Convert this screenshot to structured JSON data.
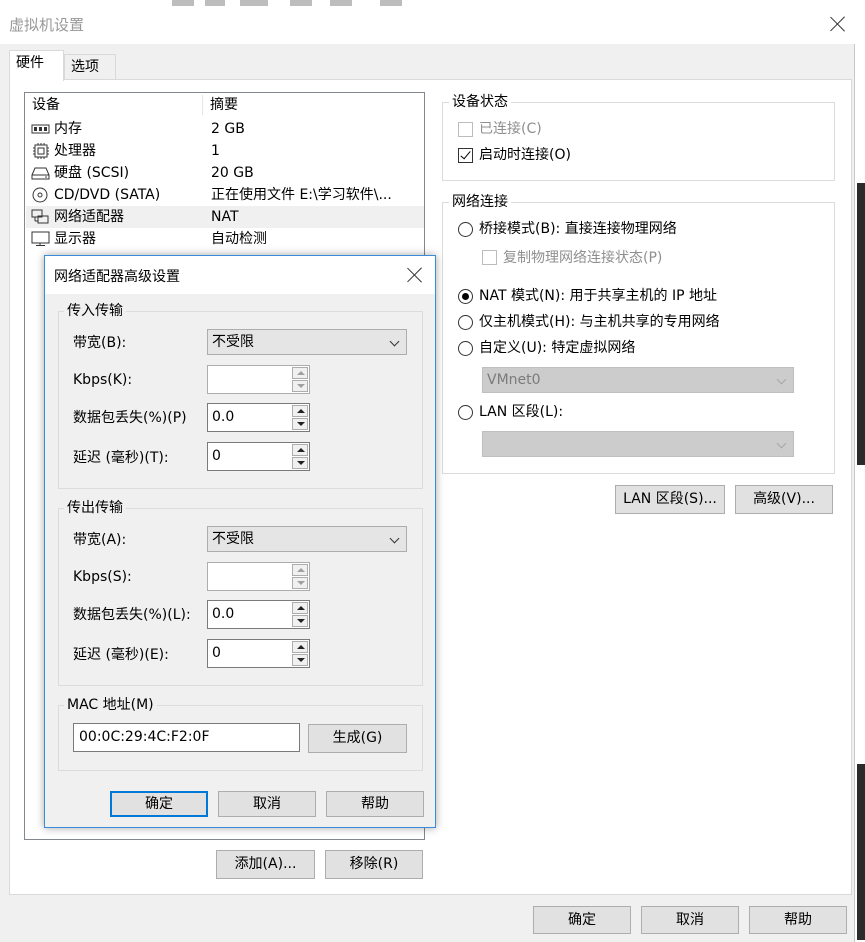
{
  "window": {
    "title": "虚拟机设置"
  },
  "tabs": [
    {
      "label": "硬件",
      "active": true
    },
    {
      "label": "选项",
      "active": false
    }
  ],
  "device_list": {
    "col_device": "设备",
    "col_summary": "摘要",
    "rows": [
      {
        "icon": "memory-icon",
        "name": "内存",
        "summary": "2 GB"
      },
      {
        "icon": "processor-icon",
        "name": "处理器",
        "summary": "1"
      },
      {
        "icon": "hard-disk-icon",
        "name": "硬盘 (SCSI)",
        "summary": "20 GB"
      },
      {
        "icon": "cd-dvd-icon",
        "name": "CD/DVD (SATA)",
        "summary": "正在使用文件 E:\\学习软件\\..."
      },
      {
        "icon": "network-adapter-icon",
        "name": "网络适配器",
        "summary": "NAT",
        "selected": true
      },
      {
        "icon": "display-icon",
        "name": "显示器",
        "summary": "自动检测"
      }
    ]
  },
  "device_buttons": {
    "add": "添加(A)...",
    "remove": "移除(R)"
  },
  "device_status": {
    "title": "设备状态",
    "connected": {
      "label": "已连接(C)",
      "checked": false,
      "disabled": true
    },
    "connect_on_power": {
      "label": "启动时连接(O)",
      "checked": true
    }
  },
  "network": {
    "title": "网络连接",
    "bridged": {
      "label": "桥接模式(B): 直接连接物理网络",
      "checked": false
    },
    "replicate": {
      "label": "复制物理网络连接状态(P)",
      "checked": false,
      "disabled": true
    },
    "nat": {
      "label": "NAT 模式(N): 用于共享主机的 IP 地址",
      "checked": true
    },
    "host_only": {
      "label": "仅主机模式(H): 与主机共享的专用网络",
      "checked": false
    },
    "custom": {
      "label": "自定义(U): 特定虚拟网络",
      "checked": false
    },
    "custom_value": "VMnet0",
    "lan_segment": {
      "label": "LAN 区段(L):",
      "checked": false
    },
    "lan_segment_value": ""
  },
  "network_buttons": {
    "lan_segments": "LAN 区段(S)...",
    "advanced": "高级(V)..."
  },
  "bottom_buttons": {
    "ok": "确定",
    "cancel": "取消",
    "help": "帮助"
  },
  "advanced_dialog": {
    "title": "网络适配器高级设置",
    "incoming": {
      "title": "传入传输",
      "bandwidth_label": "带宽(B):",
      "bandwidth_value": "不受限",
      "kbps_label": "Kbps(K):",
      "kbps_value": "",
      "loss_label": "数据包丢失(%)(P)",
      "loss_value": "0.0",
      "latency_label": "延迟 (毫秒)(T):",
      "latency_value": "0"
    },
    "outgoing": {
      "title": "传出传输",
      "bandwidth_label": "带宽(A):",
      "bandwidth_value": "不受限",
      "kbps_label": "Kbps(S):",
      "kbps_value": "",
      "loss_label": "数据包丢失(%)(L):",
      "loss_value": "0.0",
      "latency_label": "延迟 (毫秒)(E):",
      "latency_value": "0"
    },
    "mac": {
      "title": "MAC 地址(M)",
      "value": "00:0C:29:4C:F2:0F",
      "generate": "生成(G)"
    },
    "buttons": {
      "ok": "确定",
      "cancel": "取消",
      "help": "帮助"
    }
  }
}
